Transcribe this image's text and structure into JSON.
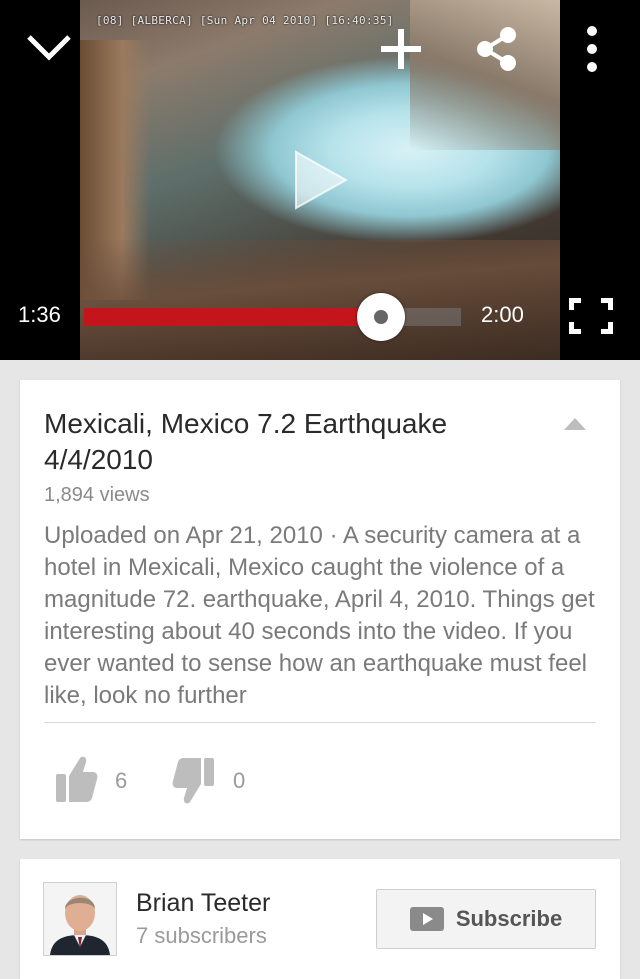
{
  "player": {
    "camera_overlay": "[08] [ALBERCA] [Sun Apr 04 2010] [16:40:35]",
    "current_time": "1:36",
    "total_time": "2:00",
    "progress_fraction": 0.787,
    "progress_color": "#c4151c"
  },
  "video": {
    "title": "Mexicali, Mexico 7.2 Earthquake 4/4/2010",
    "views": "1,894 views",
    "description": "Uploaded on Apr 21, 2010 · A security camera at a hotel in Mexicali, Mexico caught the violence of a magnitude 72. earthquake, April 4, 2010. Things get interesting about 40 seconds into the video. If you ever wanted to sense how an earthquake must feel like, look no further",
    "likes": "6",
    "dislikes": "0"
  },
  "channel": {
    "name": "Brian Teeter",
    "subscribers": "7 subscribers",
    "subscribe_label": "Subscribe"
  },
  "icons": {
    "collapse": "chevron-down-icon",
    "add": "plus-icon",
    "share": "share-icon",
    "more": "more-vert-icon",
    "play": "play-icon",
    "fullscreen": "fullscreen-icon",
    "like": "thumbs-up-icon",
    "dislike": "thumbs-down-icon",
    "subscribe": "youtube-play-icon"
  }
}
